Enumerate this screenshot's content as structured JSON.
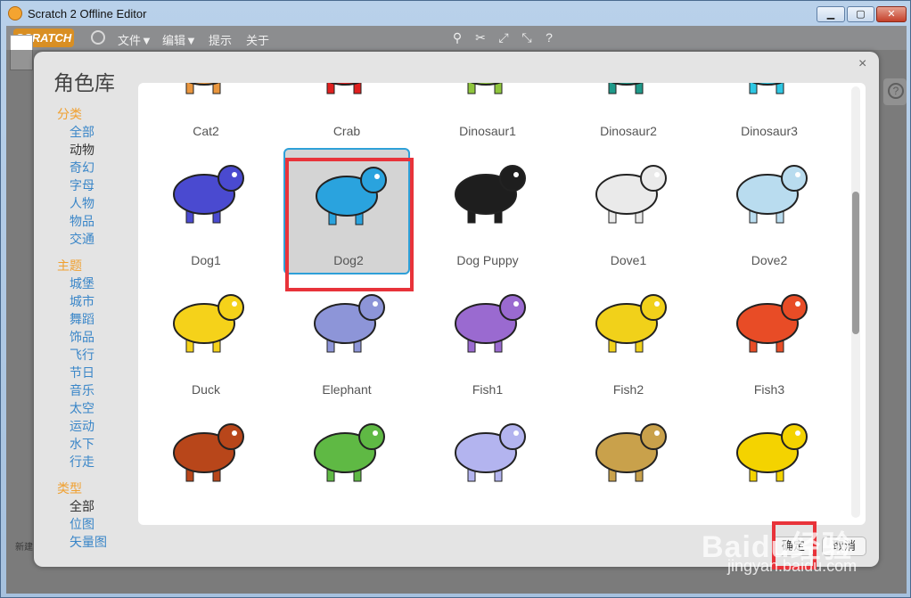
{
  "window": {
    "title": "Scratch 2 Offline Editor",
    "minimize": "▁",
    "maximize": "▢",
    "close": "✕"
  },
  "menubar": {
    "logo": "SCRATCH",
    "items": [
      "文件▼",
      "编辑▼",
      "提示",
      "关于"
    ]
  },
  "dialog": {
    "title": "角色库",
    "close": "×",
    "sidebar": {
      "category_head": "分类",
      "categories": [
        "全部",
        "动物",
        "奇幻",
        "字母",
        "人物",
        "物品",
        "交通"
      ],
      "theme_head": "主题",
      "themes": [
        "城堡",
        "城市",
        "舞蹈",
        "饰品",
        "飞行",
        "节日",
        "音乐",
        "太空",
        "运动",
        "水下",
        "行走"
      ],
      "type_head": "类型",
      "types": [
        "全部",
        "位图",
        "矢量图"
      ]
    },
    "sprites": [
      {
        "name": "Cat2",
        "color": "#e9963e"
      },
      {
        "name": "Crab",
        "color": "#e0201f"
      },
      {
        "name": "Dinosaur1",
        "color": "#8fc63d"
      },
      {
        "name": "Dinosaur2",
        "color": "#1f9a8a"
      },
      {
        "name": "Dinosaur3",
        "color": "#2ec7e3"
      },
      {
        "name": "Dog1",
        "color": "#4a4ad0"
      },
      {
        "name": "Dog2",
        "color": "#2aa3de"
      },
      {
        "name": "Dog Puppy",
        "color": "#1e1e1e"
      },
      {
        "name": "Dove1",
        "color": "#eaeaea"
      },
      {
        "name": "Dove2",
        "color": "#b9dcef"
      },
      {
        "name": "Duck",
        "color": "#f5d21a"
      },
      {
        "name": "Elephant",
        "color": "#8d95d8"
      },
      {
        "name": "Fish1",
        "color": "#9a6ad0"
      },
      {
        "name": "Fish2",
        "color": "#f1d11a"
      },
      {
        "name": "Fish3",
        "color": "#e84c26"
      },
      {
        "name": "",
        "color": "#b8461a"
      },
      {
        "name": "",
        "color": "#5fb944"
      },
      {
        "name": "",
        "color": "#b3b4ef"
      },
      {
        "name": "",
        "color": "#c9a14b"
      },
      {
        "name": "",
        "color": "#f4d300"
      }
    ],
    "selected_index": 6,
    "ok_button": "确定",
    "cancel_button": "取消"
  },
  "stage": {
    "new_sprite_label": "新建"
  },
  "watermark": {
    "brand": "Baidu经验",
    "url": "jingyan.baidu.com"
  }
}
